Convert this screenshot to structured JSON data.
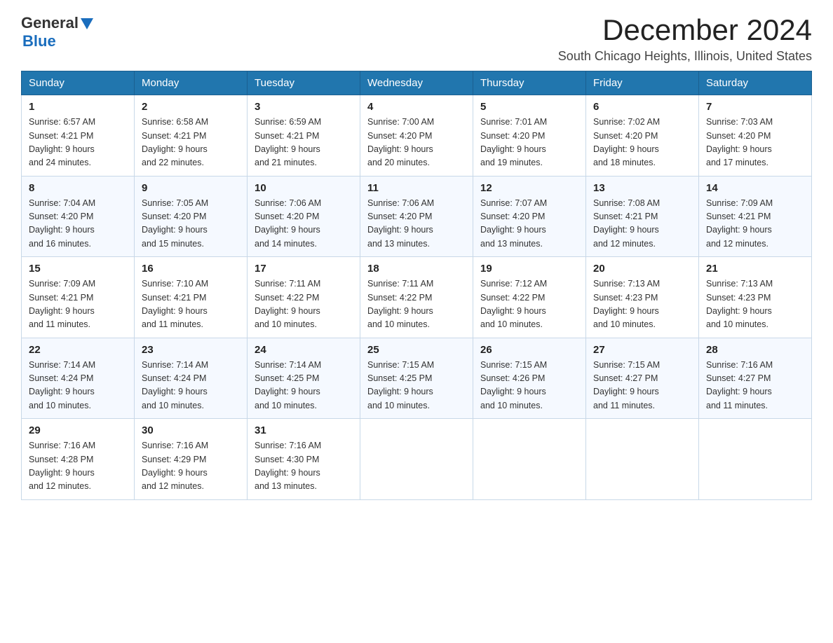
{
  "header": {
    "logo": {
      "general": "General",
      "blue": "Blue"
    },
    "title": "December 2024",
    "subtitle": "South Chicago Heights, Illinois, United States"
  },
  "weekdays": [
    "Sunday",
    "Monday",
    "Tuesday",
    "Wednesday",
    "Thursday",
    "Friday",
    "Saturday"
  ],
  "weeks": [
    [
      {
        "day": "1",
        "sunrise": "6:57 AM",
        "sunset": "4:21 PM",
        "daylight": "9 hours and 24 minutes."
      },
      {
        "day": "2",
        "sunrise": "6:58 AM",
        "sunset": "4:21 PM",
        "daylight": "9 hours and 22 minutes."
      },
      {
        "day": "3",
        "sunrise": "6:59 AM",
        "sunset": "4:21 PM",
        "daylight": "9 hours and 21 minutes."
      },
      {
        "day": "4",
        "sunrise": "7:00 AM",
        "sunset": "4:20 PM",
        "daylight": "9 hours and 20 minutes."
      },
      {
        "day": "5",
        "sunrise": "7:01 AM",
        "sunset": "4:20 PM",
        "daylight": "9 hours and 19 minutes."
      },
      {
        "day": "6",
        "sunrise": "7:02 AM",
        "sunset": "4:20 PM",
        "daylight": "9 hours and 18 minutes."
      },
      {
        "day": "7",
        "sunrise": "7:03 AM",
        "sunset": "4:20 PM",
        "daylight": "9 hours and 17 minutes."
      }
    ],
    [
      {
        "day": "8",
        "sunrise": "7:04 AM",
        "sunset": "4:20 PM",
        "daylight": "9 hours and 16 minutes."
      },
      {
        "day": "9",
        "sunrise": "7:05 AM",
        "sunset": "4:20 PM",
        "daylight": "9 hours and 15 minutes."
      },
      {
        "day": "10",
        "sunrise": "7:06 AM",
        "sunset": "4:20 PM",
        "daylight": "9 hours and 14 minutes."
      },
      {
        "day": "11",
        "sunrise": "7:06 AM",
        "sunset": "4:20 PM",
        "daylight": "9 hours and 13 minutes."
      },
      {
        "day": "12",
        "sunrise": "7:07 AM",
        "sunset": "4:20 PM",
        "daylight": "9 hours and 13 minutes."
      },
      {
        "day": "13",
        "sunrise": "7:08 AM",
        "sunset": "4:21 PM",
        "daylight": "9 hours and 12 minutes."
      },
      {
        "day": "14",
        "sunrise": "7:09 AM",
        "sunset": "4:21 PM",
        "daylight": "9 hours and 12 minutes."
      }
    ],
    [
      {
        "day": "15",
        "sunrise": "7:09 AM",
        "sunset": "4:21 PM",
        "daylight": "9 hours and 11 minutes."
      },
      {
        "day": "16",
        "sunrise": "7:10 AM",
        "sunset": "4:21 PM",
        "daylight": "9 hours and 11 minutes."
      },
      {
        "day": "17",
        "sunrise": "7:11 AM",
        "sunset": "4:22 PM",
        "daylight": "9 hours and 10 minutes."
      },
      {
        "day": "18",
        "sunrise": "7:11 AM",
        "sunset": "4:22 PM",
        "daylight": "9 hours and 10 minutes."
      },
      {
        "day": "19",
        "sunrise": "7:12 AM",
        "sunset": "4:22 PM",
        "daylight": "9 hours and 10 minutes."
      },
      {
        "day": "20",
        "sunrise": "7:13 AM",
        "sunset": "4:23 PM",
        "daylight": "9 hours and 10 minutes."
      },
      {
        "day": "21",
        "sunrise": "7:13 AM",
        "sunset": "4:23 PM",
        "daylight": "9 hours and 10 minutes."
      }
    ],
    [
      {
        "day": "22",
        "sunrise": "7:14 AM",
        "sunset": "4:24 PM",
        "daylight": "9 hours and 10 minutes."
      },
      {
        "day": "23",
        "sunrise": "7:14 AM",
        "sunset": "4:24 PM",
        "daylight": "9 hours and 10 minutes."
      },
      {
        "day": "24",
        "sunrise": "7:14 AM",
        "sunset": "4:25 PM",
        "daylight": "9 hours and 10 minutes."
      },
      {
        "day": "25",
        "sunrise": "7:15 AM",
        "sunset": "4:25 PM",
        "daylight": "9 hours and 10 minutes."
      },
      {
        "day": "26",
        "sunrise": "7:15 AM",
        "sunset": "4:26 PM",
        "daylight": "9 hours and 10 minutes."
      },
      {
        "day": "27",
        "sunrise": "7:15 AM",
        "sunset": "4:27 PM",
        "daylight": "9 hours and 11 minutes."
      },
      {
        "day": "28",
        "sunrise": "7:16 AM",
        "sunset": "4:27 PM",
        "daylight": "9 hours and 11 minutes."
      }
    ],
    [
      {
        "day": "29",
        "sunrise": "7:16 AM",
        "sunset": "4:28 PM",
        "daylight": "9 hours and 12 minutes."
      },
      {
        "day": "30",
        "sunrise": "7:16 AM",
        "sunset": "4:29 PM",
        "daylight": "9 hours and 12 minutes."
      },
      {
        "day": "31",
        "sunrise": "7:16 AM",
        "sunset": "4:30 PM",
        "daylight": "9 hours and 13 minutes."
      },
      null,
      null,
      null,
      null
    ]
  ],
  "labels": {
    "sunrise": "Sunrise:",
    "sunset": "Sunset:",
    "daylight": "Daylight:"
  }
}
